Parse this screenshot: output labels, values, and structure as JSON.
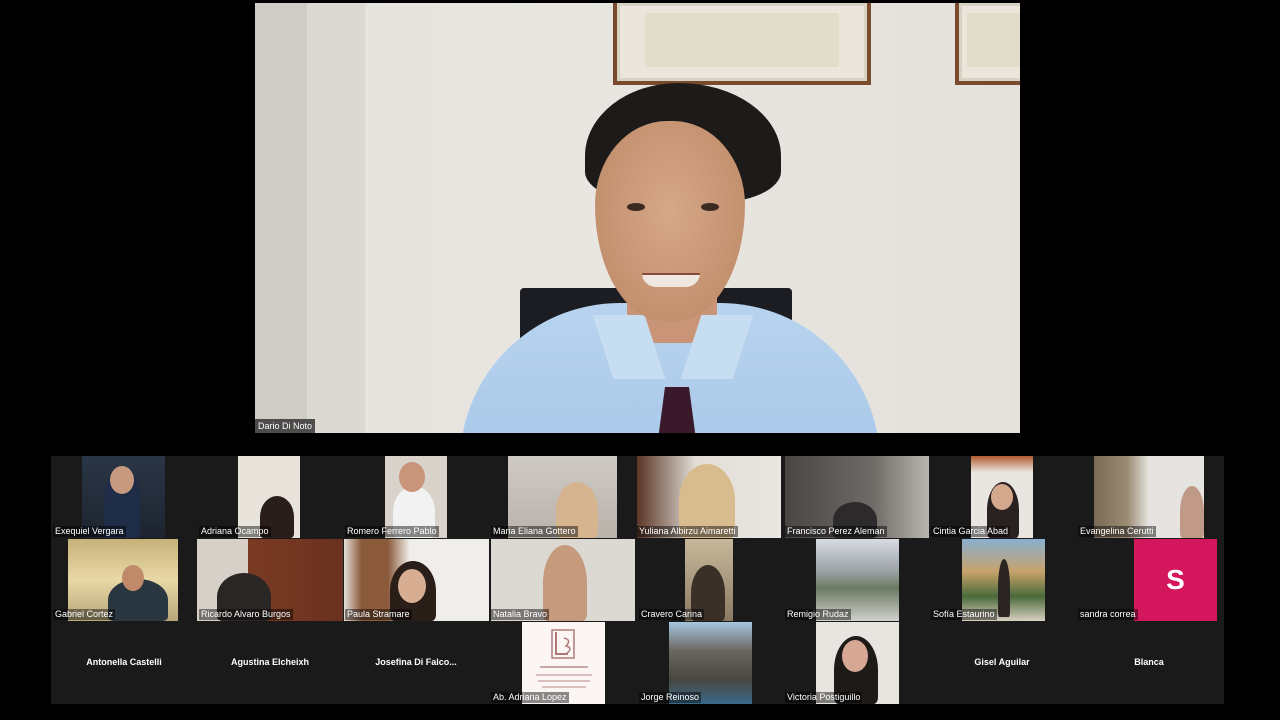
{
  "speaker": {
    "name": "Dario Di Noto"
  },
  "participants": [
    {
      "name": "Exequiel Vergara",
      "has_video": true
    },
    {
      "name": "Adriana Ocampo",
      "has_video": true
    },
    {
      "name": "Romero Ferrero Pablo",
      "has_video": true
    },
    {
      "name": "Maria Eliana Gottero",
      "has_video": true
    },
    {
      "name": "Yuliana Albirzu Aimaretti",
      "has_video": true
    },
    {
      "name": "Francisco Perez Aleman",
      "has_video": true
    },
    {
      "name": "Cintia Garcia Abad",
      "has_video": true
    },
    {
      "name": "Evangelina Cerutti",
      "has_video": true
    },
    {
      "name": "Gabriel Cortez",
      "has_video": true
    },
    {
      "name": "Ricardo Alvaro Burgos",
      "has_video": true
    },
    {
      "name": "Paula Stramare",
      "has_video": true
    },
    {
      "name": "Natalia Bravo",
      "has_video": true
    },
    {
      "name": "Cravero Carina",
      "has_video": true
    },
    {
      "name": "Remigio Rudaz",
      "has_video": true
    },
    {
      "name": "Sofía Estaurino",
      "has_video": true
    },
    {
      "name": "sandra correa",
      "has_video": false,
      "avatar_letter": "S",
      "avatar_color": "#d4175d"
    },
    {
      "name": "Antonella Castelli",
      "has_video": false
    },
    {
      "name": "Agustina Elcheixh",
      "has_video": false
    },
    {
      "name": "Josefina Di Falco...",
      "has_video": false
    },
    {
      "name": "Ab. Adriana Lopez",
      "has_video": true
    },
    {
      "name": "Jorge Reinoso",
      "has_video": true
    },
    {
      "name": "Victoria Postiguillo",
      "has_video": true
    },
    {
      "name": "Gisel Aguilar",
      "has_video": false
    },
    {
      "name": "Blanca",
      "has_video": false
    }
  ],
  "colors": {
    "background": "#000000",
    "gallery": "#1a1a1a",
    "avatar_pink": "#d4175d"
  }
}
